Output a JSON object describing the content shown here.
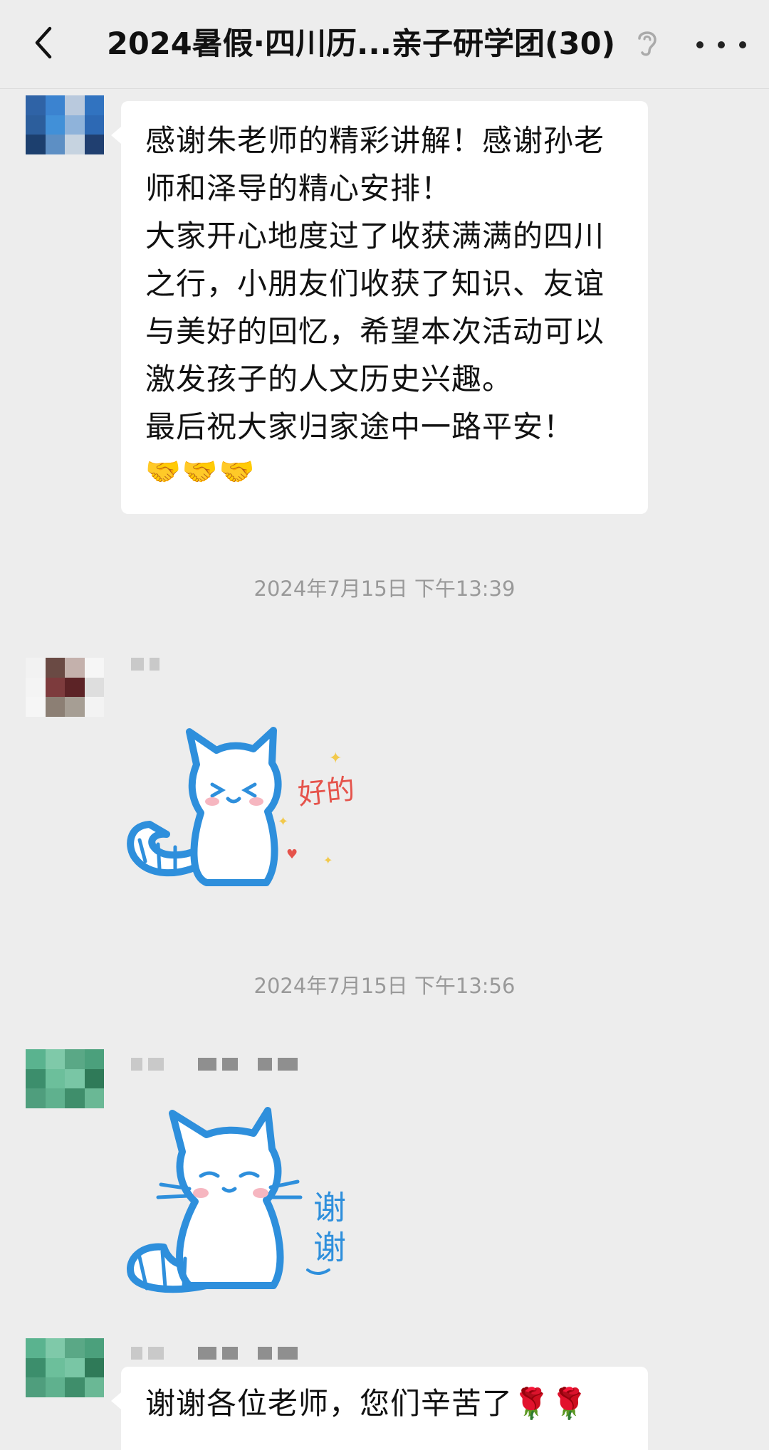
{
  "header": {
    "title": "2024暑假·四川历...亲子研学团(30)",
    "back_icon": "chevron-left-icon",
    "ear_icon": "ear-icon",
    "more_icon": "more-dots-icon"
  },
  "messages": [
    {
      "type": "text",
      "text": "感谢朱老师的精彩讲解！感谢孙老\n师和泽导的精心安排！\n大家开心地度过了收获满满的四川\n之行，小朋友们收获了知识、友谊\n与美好的回忆，希望本次活动可以\n激发孩子的人文历史兴趣。\n最后祝大家归家途中一路平安！",
      "emoji": "🤝🤝🤝"
    },
    {
      "type": "sticker",
      "sticker_text": "好的"
    },
    {
      "type": "sticker",
      "sticker_text": "谢谢"
    },
    {
      "type": "text",
      "text": "谢谢各位老师，您们辛苦了🌹🌹"
    }
  ],
  "timestamps": [
    "2024年7月15日 下午13:39",
    "2024年7月15日 下午13:56"
  ],
  "colors": {
    "background": "#ededed",
    "bubble": "#ffffff",
    "sticker_blue": "#2e8fdc"
  }
}
